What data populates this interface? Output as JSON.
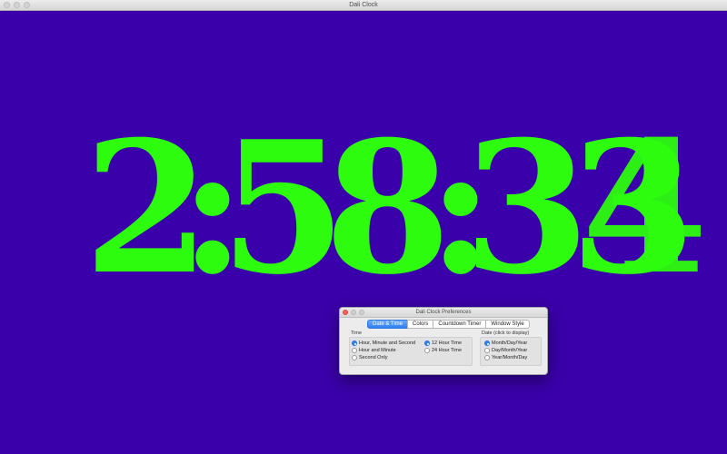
{
  "main_window": {
    "title": "Dali Clock"
  },
  "clock": {
    "d1": "2",
    "c1": ":",
    "d2": "5",
    "d3": "8",
    "c2": ":",
    "d4": "3",
    "d5a": "3",
    "d5b": "4",
    "color": "#2dfc0f",
    "background": "#3a00aa"
  },
  "prefs": {
    "title": "Dali Clock Preferences",
    "tabs": [
      "Date & Time",
      "Colors",
      "Countdown Timer",
      "Window Style"
    ],
    "time_group": "Time",
    "time_options": [
      "Hour, Minute and Second",
      "Hour and Minute",
      "Second Only"
    ],
    "hour_options": [
      "12 Hour Time",
      "24 Hour Time"
    ],
    "date_group": "Date (click to display)",
    "date_options": [
      "Month/Day/Year",
      "Day/Month/Year",
      "Year/Month/Day"
    ]
  }
}
